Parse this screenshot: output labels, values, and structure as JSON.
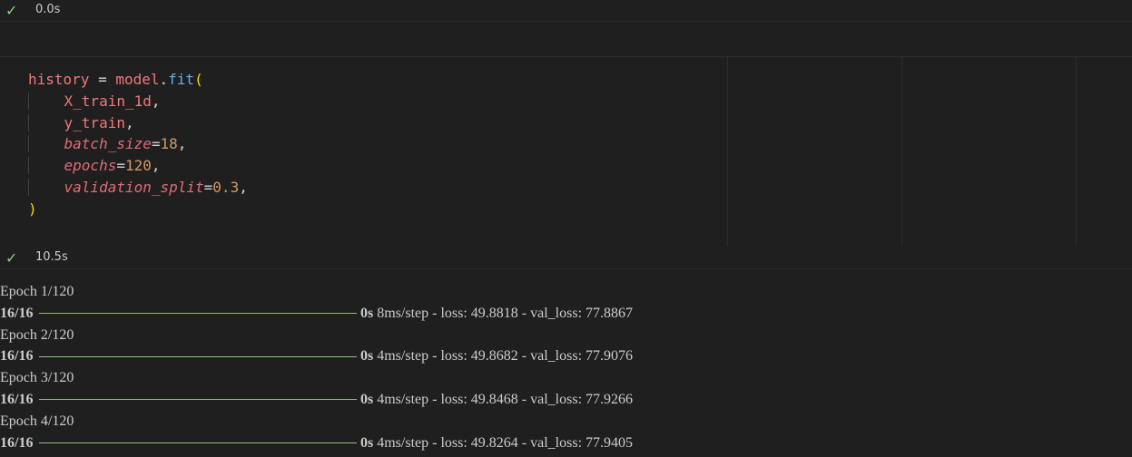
{
  "cells": {
    "top_status": {
      "check_icon": "check-icon",
      "time": "0.0s"
    },
    "code_cell": {
      "lines": [
        {
          "indent": false,
          "tokens": [
            [
              "var",
              "history"
            ],
            [
              "op",
              " = "
            ],
            [
              "var",
              "model"
            ],
            [
              "op",
              "."
            ],
            [
              "fn",
              "fit"
            ],
            [
              "paren",
              "("
            ]
          ]
        },
        {
          "indent": true,
          "tokens": [
            [
              "var",
              "X_train_1d"
            ],
            [
              "punct",
              ","
            ]
          ]
        },
        {
          "indent": true,
          "tokens": [
            [
              "var",
              "y_train"
            ],
            [
              "punct",
              ","
            ]
          ]
        },
        {
          "indent": true,
          "tokens": [
            [
              "kw",
              "batch_size"
            ],
            [
              "op",
              "="
            ],
            [
              "num",
              "18"
            ],
            [
              "punct",
              ","
            ]
          ]
        },
        {
          "indent": true,
          "tokens": [
            [
              "kw",
              "epochs"
            ],
            [
              "op",
              "="
            ],
            [
              "num",
              "120"
            ],
            [
              "punct",
              ","
            ]
          ]
        },
        {
          "indent": true,
          "tokens": [
            [
              "kw",
              "validation_split"
            ],
            [
              "op",
              "="
            ],
            [
              "num",
              "0.3"
            ],
            [
              "punct",
              ","
            ]
          ]
        },
        {
          "indent": false,
          "tokens": [
            [
              "paren",
              ")"
            ]
          ]
        }
      ]
    },
    "bottom_status": {
      "check_icon": "check-icon",
      "time": "10.5s"
    }
  },
  "output": {
    "epochs": [
      {
        "epoch_label": "Epoch 1/120",
        "progress": "16/16",
        "time": "0s",
        "rest": " 8ms/step - loss: 49.8818 - val_loss: 77.8867"
      },
      {
        "epoch_label": "Epoch 2/120",
        "progress": "16/16",
        "time": "0s",
        "rest": " 4ms/step - loss: 49.8682 - val_loss: 77.9076"
      },
      {
        "epoch_label": "Epoch 3/120",
        "progress": "16/16",
        "time": "0s",
        "rest": " 4ms/step - loss: 49.8468 - val_loss: 77.9266"
      },
      {
        "epoch_label": "Epoch 4/120",
        "progress": "16/16",
        "time": "0s",
        "rest": " 4ms/step - loss: 49.8264 - val_loss: 77.9405"
      }
    ]
  },
  "colors": {
    "background": "#1f1f1f",
    "success": "#89d185",
    "progress_bar": "#8fc07a"
  }
}
